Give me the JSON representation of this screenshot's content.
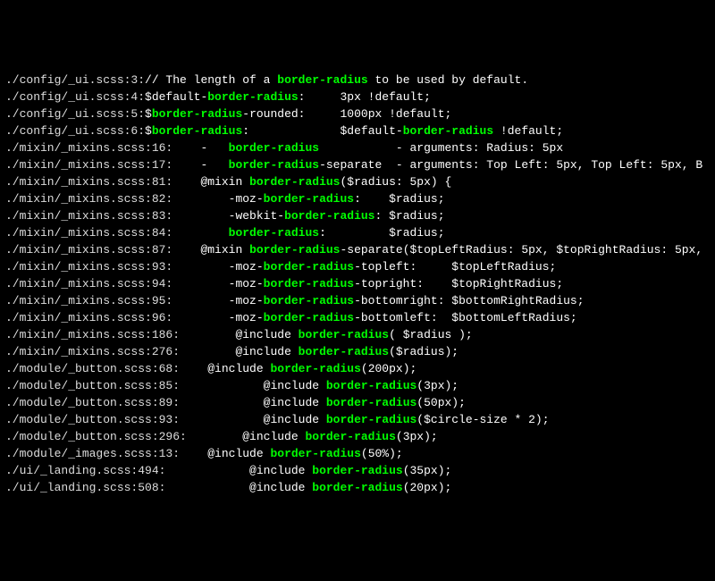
{
  "lines": [
    {
      "segments": [
        {
          "t": "./config/_ui.scss:3:",
          "c": "fp"
        },
        {
          "t": "// The length of a ",
          "c": ""
        },
        {
          "t": "border-radius",
          "c": "hl"
        },
        {
          "t": " to be used by default.",
          "c": ""
        }
      ]
    },
    {
      "segments": [
        {
          "t": "./config/_ui.scss:4:",
          "c": "fp"
        },
        {
          "t": "$default-",
          "c": ""
        },
        {
          "t": "border-radius",
          "c": "hl"
        },
        {
          "t": ":     3px !default;",
          "c": ""
        }
      ]
    },
    {
      "segments": [
        {
          "t": "./config/_ui.scss:5:",
          "c": "fp"
        },
        {
          "t": "$",
          "c": ""
        },
        {
          "t": "border-radius",
          "c": "hl"
        },
        {
          "t": "-rounded:     1000px !default;",
          "c": ""
        }
      ]
    },
    {
      "segments": [
        {
          "t": "./config/_ui.scss:6:",
          "c": "fp"
        },
        {
          "t": "$",
          "c": ""
        },
        {
          "t": "border-radius",
          "c": "hl"
        },
        {
          "t": ":             $default-",
          "c": ""
        },
        {
          "t": "border-radius",
          "c": "hl"
        },
        {
          "t": " !default;",
          "c": ""
        }
      ]
    },
    {
      "segments": [
        {
          "t": "./mixin/_mixins.scss:16:",
          "c": "fp"
        },
        {
          "t": "    -   ",
          "c": ""
        },
        {
          "t": "border-radius",
          "c": "hl"
        },
        {
          "t": "           - arguments: Radius: 5px",
          "c": ""
        }
      ]
    },
    {
      "segments": [
        {
          "t": "./mixin/_mixins.scss:17:",
          "c": "fp"
        },
        {
          "t": "    -   ",
          "c": ""
        },
        {
          "t": "border-radius",
          "c": "hl"
        },
        {
          "t": "-separate  - arguments: Top Left: 5px, Top Left: 5px, B",
          "c": ""
        }
      ]
    },
    {
      "segments": [
        {
          "t": "./mixin/_mixins.scss:81:",
          "c": "fp"
        },
        {
          "t": "    @mixin ",
          "c": ""
        },
        {
          "t": "border-radius",
          "c": "hl"
        },
        {
          "t": "($radius: 5px) {",
          "c": ""
        }
      ]
    },
    {
      "segments": [
        {
          "t": "./mixin/_mixins.scss:82:",
          "c": "fp"
        },
        {
          "t": "        -moz-",
          "c": ""
        },
        {
          "t": "border-radius",
          "c": "hl"
        },
        {
          "t": ":    $radius;",
          "c": ""
        }
      ]
    },
    {
      "segments": [
        {
          "t": "./mixin/_mixins.scss:83:",
          "c": "fp"
        },
        {
          "t": "        -webkit-",
          "c": ""
        },
        {
          "t": "border-radius",
          "c": "hl"
        },
        {
          "t": ": $radius;",
          "c": ""
        }
      ]
    },
    {
      "segments": [
        {
          "t": "./mixin/_mixins.scss:84:",
          "c": "fp"
        },
        {
          "t": "        ",
          "c": ""
        },
        {
          "t": "border-radius",
          "c": "hl"
        },
        {
          "t": ":         $radius;",
          "c": ""
        }
      ]
    },
    {
      "segments": [
        {
          "t": "./mixin/_mixins.scss:87:",
          "c": "fp"
        },
        {
          "t": "    @mixin ",
          "c": ""
        },
        {
          "t": "border-radius",
          "c": "hl"
        },
        {
          "t": "-separate($topLeftRadius: 5px, $topRightRadius: 5px,",
          "c": ""
        }
      ]
    },
    {
      "segments": [
        {
          "t": "./mixin/_mixins.scss:93:",
          "c": "fp"
        },
        {
          "t": "        -moz-",
          "c": ""
        },
        {
          "t": "border-radius",
          "c": "hl"
        },
        {
          "t": "-topleft:     $topLeftRadius;",
          "c": ""
        }
      ]
    },
    {
      "segments": [
        {
          "t": "./mixin/_mixins.scss:94:",
          "c": "fp"
        },
        {
          "t": "        -moz-",
          "c": ""
        },
        {
          "t": "border-radius",
          "c": "hl"
        },
        {
          "t": "-topright:    $topRightRadius;",
          "c": ""
        }
      ]
    },
    {
      "segments": [
        {
          "t": "./mixin/_mixins.scss:95:",
          "c": "fp"
        },
        {
          "t": "        -moz-",
          "c": ""
        },
        {
          "t": "border-radius",
          "c": "hl"
        },
        {
          "t": "-bottomright: $bottomRightRadius;",
          "c": ""
        }
      ]
    },
    {
      "segments": [
        {
          "t": "./mixin/_mixins.scss:96:",
          "c": "fp"
        },
        {
          "t": "        -moz-",
          "c": ""
        },
        {
          "t": "border-radius",
          "c": "hl"
        },
        {
          "t": "-bottomleft:  $bottomLeftRadius;",
          "c": ""
        }
      ]
    },
    {
      "segments": [
        {
          "t": "./mixin/_mixins.scss:186:",
          "c": "fp"
        },
        {
          "t": "        @include ",
          "c": ""
        },
        {
          "t": "border-radius",
          "c": "hl"
        },
        {
          "t": "( $radius );",
          "c": ""
        }
      ]
    },
    {
      "segments": [
        {
          "t": "./mixin/_mixins.scss:276:",
          "c": "fp"
        },
        {
          "t": "        @include ",
          "c": ""
        },
        {
          "t": "border-radius",
          "c": "hl"
        },
        {
          "t": "($radius);",
          "c": ""
        }
      ]
    },
    {
      "segments": [
        {
          "t": "./module/_button.scss:68:",
          "c": "fp"
        },
        {
          "t": "    @include ",
          "c": ""
        },
        {
          "t": "border-radius",
          "c": "hl"
        },
        {
          "t": "(200px);",
          "c": ""
        }
      ]
    },
    {
      "segments": [
        {
          "t": "./module/_button.scss:85:",
          "c": "fp"
        },
        {
          "t": "            @include ",
          "c": ""
        },
        {
          "t": "border-radius",
          "c": "hl"
        },
        {
          "t": "(3px);",
          "c": ""
        }
      ]
    },
    {
      "segments": [
        {
          "t": "./module/_button.scss:89:",
          "c": "fp"
        },
        {
          "t": "            @include ",
          "c": ""
        },
        {
          "t": "border-radius",
          "c": "hl"
        },
        {
          "t": "(50px);",
          "c": ""
        }
      ]
    },
    {
      "segments": [
        {
          "t": "./module/_button.scss:93:",
          "c": "fp"
        },
        {
          "t": "            @include ",
          "c": ""
        },
        {
          "t": "border-radius",
          "c": "hl"
        },
        {
          "t": "($circle-size * 2);",
          "c": ""
        }
      ]
    },
    {
      "segments": [
        {
          "t": "./module/_button.scss:296:",
          "c": "fp"
        },
        {
          "t": "        @include ",
          "c": ""
        },
        {
          "t": "border-radius",
          "c": "hl"
        },
        {
          "t": "(3px);",
          "c": ""
        }
      ]
    },
    {
      "segments": [
        {
          "t": "./module/_images.scss:13:",
          "c": "fp"
        },
        {
          "t": "    @include ",
          "c": ""
        },
        {
          "t": "border-radius",
          "c": "hl"
        },
        {
          "t": "(50%);",
          "c": ""
        }
      ]
    },
    {
      "segments": [
        {
          "t": "./ui/_landing.scss:494:",
          "c": "fp"
        },
        {
          "t": "            @include ",
          "c": ""
        },
        {
          "t": "border-radius",
          "c": "hl"
        },
        {
          "t": "(35px);",
          "c": ""
        }
      ]
    },
    {
      "segments": [
        {
          "t": "./ui/_landing.scss:508:",
          "c": "fp"
        },
        {
          "t": "            @include ",
          "c": ""
        },
        {
          "t": "border-radius",
          "c": "hl"
        },
        {
          "t": "(20px);",
          "c": ""
        }
      ]
    }
  ]
}
